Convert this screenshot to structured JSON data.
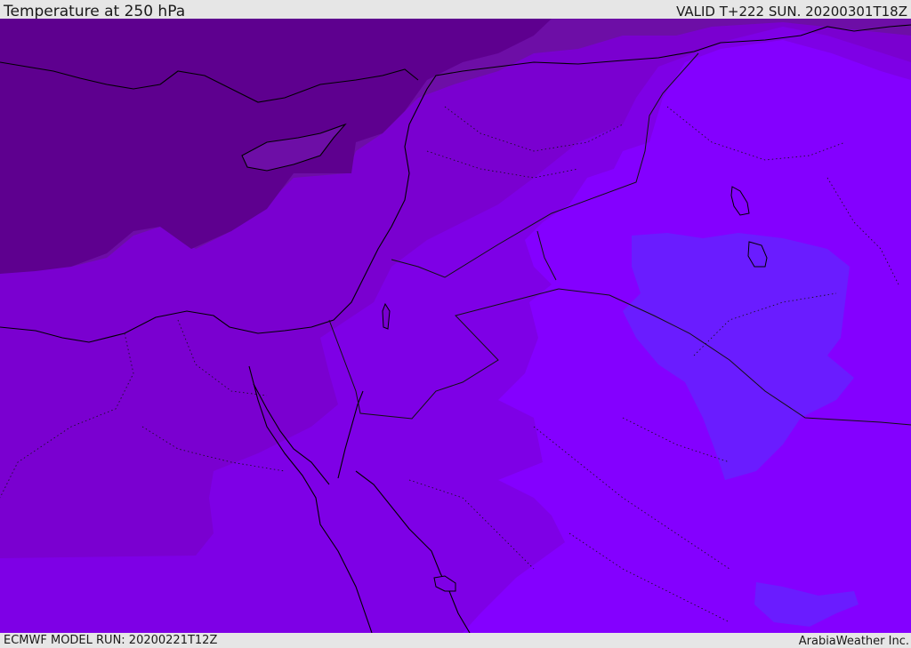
{
  "header": {
    "title": "Temperature at 250 hPa",
    "valid": "VALID T+222 SUN. 20200301T18Z"
  },
  "footer": {
    "model_run": "ECMWF MODEL RUN: 20200221T12Z",
    "credit": "ArabiaWeather Inc."
  },
  "map": {
    "field": "temperature",
    "level": "250 hPa",
    "colors": {
      "coldest": "#5e008f",
      "cold": "#6d0ea6",
      "mid": "#7a00d0",
      "warm": "#7e00e6",
      "warmest": "#8400ff",
      "pocket": "#6a1cff",
      "coast": "#000000",
      "border": "#111111"
    }
  }
}
